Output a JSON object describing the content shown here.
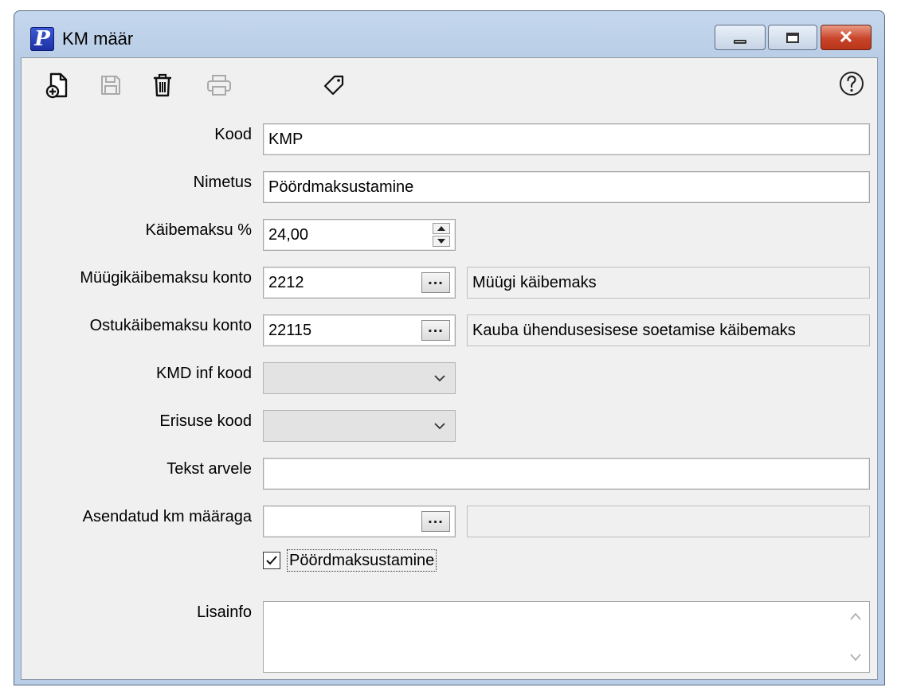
{
  "window": {
    "title": "KM määr",
    "app_icon_letter": "P",
    "controls": {
      "minimize": "minimize",
      "restore": "restore",
      "close": "✕"
    }
  },
  "toolbar": {
    "icons": [
      "new-document-icon",
      "save-icon",
      "delete-icon",
      "print-icon",
      "tag-icon",
      "help-icon"
    ]
  },
  "form": {
    "kood": {
      "label": "Kood",
      "value": "KMP"
    },
    "nimetus": {
      "label": "Nimetus",
      "value": "Pöördmaksustamine"
    },
    "kaibemaksu": {
      "label": "Käibemaksu %",
      "value": "24,00"
    },
    "muugi_konto": {
      "label": "Müügikäibemaksu konto",
      "value": "2212",
      "button": "...",
      "description": "Müügi käibemaks"
    },
    "ostu_konto": {
      "label": "Ostukäibemaksu konto",
      "value": "22115",
      "button": "...",
      "description": "Kauba ühendusesisese soetamise käibemaks"
    },
    "kmd_inf_kood": {
      "label": "KMD inf kood",
      "value": ""
    },
    "erisuse_kood": {
      "label": "Erisuse kood",
      "value": ""
    },
    "tekst_arvele": {
      "label": "Tekst arvele",
      "value": ""
    },
    "asendatud": {
      "label": "Asendatud km määraga",
      "value": "",
      "button": "...",
      "description": ""
    },
    "poordmaksustamine_checkbox": {
      "label": "Pöördmaksustamine",
      "checked": true
    },
    "lisainfo": {
      "label": "Lisainfo",
      "value": ""
    }
  }
}
